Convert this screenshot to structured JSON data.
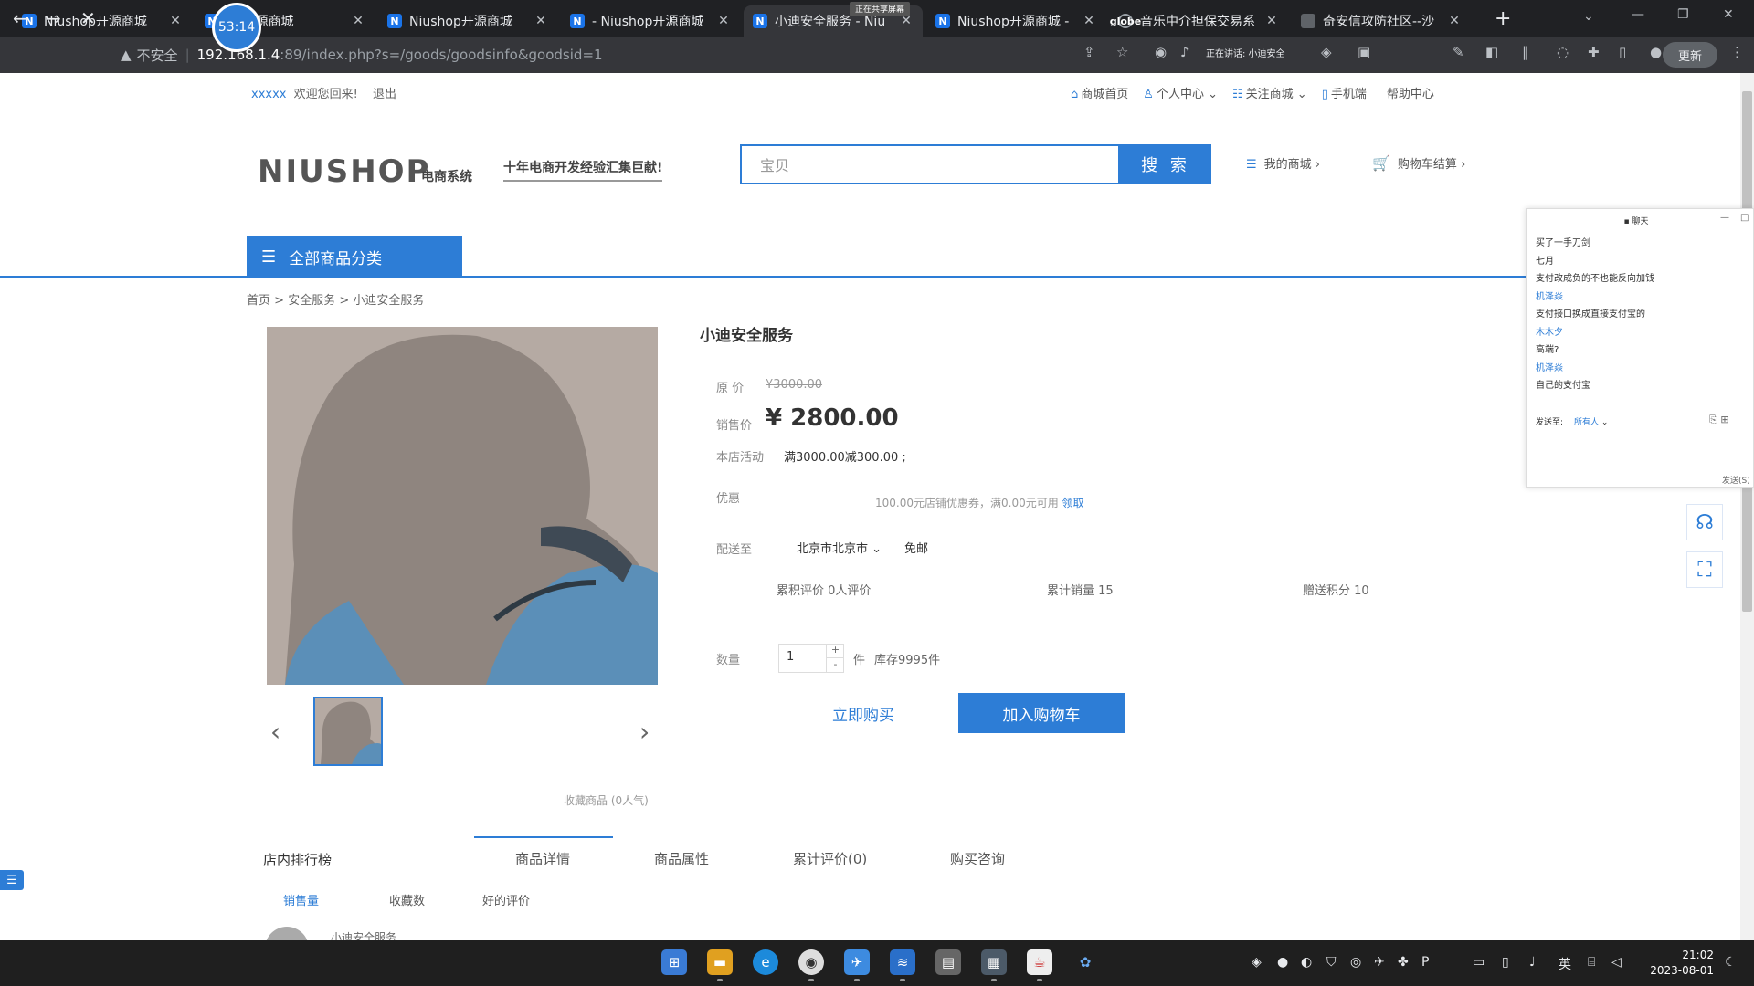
{
  "browser": {
    "tabs": [
      {
        "title": "Niushop开源商城",
        "fav": "N",
        "active": false
      },
      {
        "title": "op开源商城",
        "fav": "N",
        "active": false
      },
      {
        "title": "Niushop开源商城",
        "fav": "N",
        "active": false
      },
      {
        "title": "- Niushop开源商城",
        "fav": "N",
        "active": false
      },
      {
        "title": "小迪安全服务 - Niu",
        "fav": "N",
        "active": true
      },
      {
        "title": "Niushop开源商城 -",
        "fav": "N",
        "active": false
      },
      {
        "title": "音乐中介担保交易系",
        "fav": "globe",
        "active": false
      },
      {
        "title": "奇安信攻防社区--沙",
        "fav": "",
        "active": false
      }
    ],
    "timer": "53:14",
    "share_banner": "正在共享屏幕",
    "address": {
      "security": "不安全",
      "host": "192.168.1.4",
      "path": ":89/index.php?s=/goods/goodsinfo&goodsid=1"
    },
    "extension_label": "正在讲话: 小迪安全",
    "update_label": "更新"
  },
  "site": {
    "welcome_user": "xxxxx",
    "welcome_text": "欢迎您回来!",
    "logout": "退出",
    "top_links": [
      "商城首页",
      "个人中心",
      "关注商城",
      "手机端",
      "帮助中心"
    ],
    "logo": "NIUSHOP",
    "logo_sub": "电商系统",
    "slogan": "十年电商开发经验汇集巨献!",
    "search_placeholder": "宝贝",
    "search_button": "搜 索",
    "my_shop": "我的商城",
    "cart": "购物车结算",
    "category_button": "全部商品分类"
  },
  "breadcrumb": [
    "首页",
    "安全服务",
    "小迪安全服务"
  ],
  "product": {
    "title": "小迪安全服务",
    "orig_price_label": "原 价",
    "orig_price": "¥3000.00",
    "sale_price_label": "销售价",
    "sale_price": "¥ 2800.00",
    "promo_label": "本店活动",
    "promo": "满3000.00减300.00 ;",
    "coupon_label": "优惠",
    "coupon": "100.00元店铺优惠券，满0.00元可用",
    "coupon_get": "领取",
    "ship_label": "配送至",
    "region": "北京市北京市",
    "free_ship": "免邮",
    "stats": {
      "reviews": "累积评价 0人评价",
      "sales": "累计销量 15",
      "points": "赠送积分 10"
    },
    "qty_label": "数量",
    "qty": "1",
    "unit": "件",
    "stock": "库存9995件",
    "buy_now": "立即购买",
    "add_cart": "加入购物车",
    "collect": "收藏商品 (0人气)"
  },
  "rank": {
    "title": "店内排行榜",
    "tabs": [
      "销售量",
      "收藏数",
      "好的评价"
    ],
    "first_item": "小迪安全服务"
  },
  "detail_tabs": [
    "商品详情",
    "商品属性",
    "累计评价(0)",
    "购买咨询"
  ],
  "chat": {
    "title": "聊天",
    "messages": [
      {
        "text": "买了一手刀剑",
        "type": "txt"
      },
      {
        "text": "七月",
        "type": "txt"
      },
      {
        "text": "支付改成负的不也能反向加钱",
        "type": "txt"
      },
      {
        "text": "机泽焱",
        "type": "name"
      },
      {
        "text": "支付接口换成直接支付宝的",
        "type": "txt"
      },
      {
        "text": "木木夕",
        "type": "name"
      },
      {
        "text": "高端?",
        "type": "txt"
      },
      {
        "text": "机泽焱",
        "type": "name"
      },
      {
        "text": "自己的支付宝",
        "type": "txt"
      }
    ],
    "send_to_label": "发送至:",
    "send_to_value": "所有人",
    "send_label": "发送(S)"
  },
  "taskbar": {
    "ime": "英",
    "time": "21:02",
    "date": "2023-08-01"
  }
}
